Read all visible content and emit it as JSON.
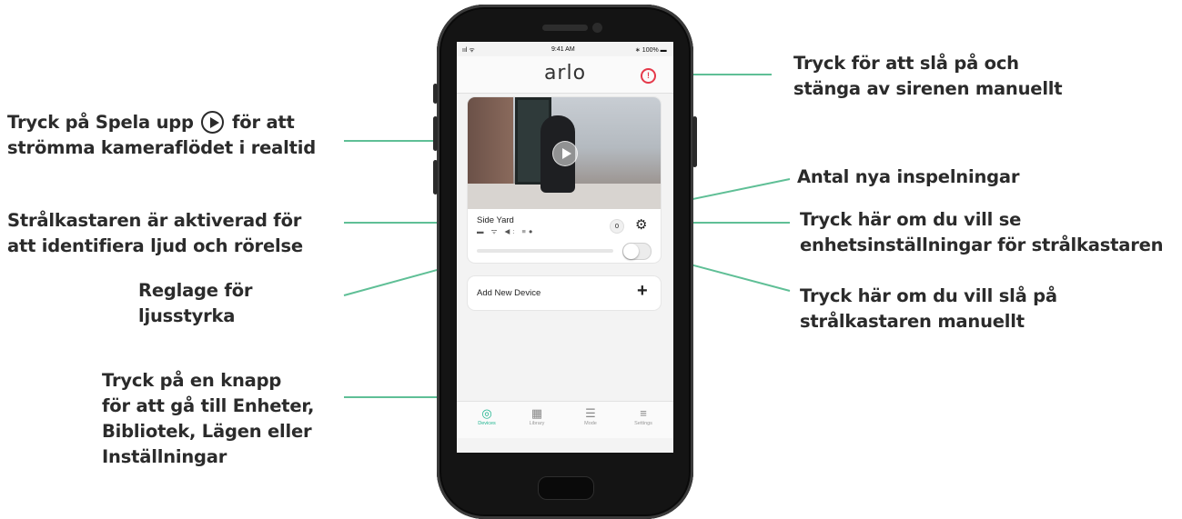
{
  "status_bar": {
    "signal": "ııl ᯤ",
    "time": "9:41 AM",
    "battery": "∗ 100% ▬"
  },
  "app": {
    "logo": "arlo",
    "siren_icon": "siren-alert-icon",
    "device": {
      "name": "Side Yard",
      "status_icons": "▬ ᯤ ◀: ≡●",
      "new_recordings": "0",
      "settings_icon": "gear-icon",
      "brightness_level": 0,
      "light_on": false
    },
    "add_device": {
      "label": "Add New Device",
      "plus": "+"
    },
    "tabs": [
      {
        "label": "Devices",
        "icon": "◎"
      },
      {
        "label": "Library",
        "icon": "▦"
      },
      {
        "label": "Mode",
        "icon": "☰"
      },
      {
        "label": "Settings",
        "icon": "≡"
      }
    ],
    "accent_color": "#1fb58f",
    "siren_color": "#e5394a"
  },
  "callouts": {
    "play_line1_pre": "Tryck på Spela upp",
    "play_line1_post": "för att",
    "play_line2": "strömma kameraflödet i realtid",
    "spot_line1": "Strålkastaren är aktiverad för",
    "spot_line2": "att identifiera ljud och rörelse",
    "bright_line1": "Reglage för",
    "bright_line2": "ljusstyrka",
    "nav_line1": "Tryck på en knapp",
    "nav_line2": "för att gå till Enheter,",
    "nav_line3": "Bibliotek, Lägen eller",
    "nav_line4": "Inställningar",
    "siren_line1": "Tryck för att slå på och",
    "siren_line2": "stänga av sirenen manuellt",
    "rec_line1": "Antal nya inspelningar",
    "settings_line1": "Tryck här om du vill se",
    "settings_line2": "enhetsinställningar för strålkastaren",
    "light_line1": "Tryck här om du vill slå på",
    "light_line2": "strålkastaren manuellt",
    "line_color": "#5fbf96"
  }
}
